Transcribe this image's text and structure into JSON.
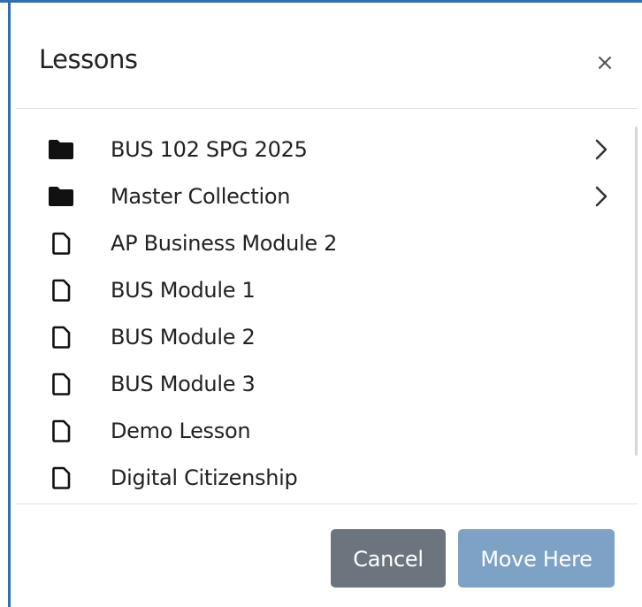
{
  "dialog": {
    "title": "Lessons",
    "close_glyph": "×",
    "close_icon": "close-icon"
  },
  "items": [
    {
      "label": "BUS 102 SPG 2025",
      "type": "folder",
      "icon": "folder-icon",
      "has_children": true
    },
    {
      "label": "Master Collection",
      "type": "folder",
      "icon": "folder-icon",
      "has_children": true
    },
    {
      "label": "AP Business Module 2",
      "type": "lesson",
      "icon": "file-icon",
      "has_children": false
    },
    {
      "label": "BUS Module 1",
      "type": "lesson",
      "icon": "file-icon",
      "has_children": false
    },
    {
      "label": "BUS Module 2",
      "type": "lesson",
      "icon": "file-icon",
      "has_children": false
    },
    {
      "label": "BUS Module 3",
      "type": "lesson",
      "icon": "file-icon",
      "has_children": false
    },
    {
      "label": "Demo Lesson",
      "type": "lesson",
      "icon": "file-icon",
      "has_children": false
    },
    {
      "label": "Digital Citizenship",
      "type": "lesson",
      "icon": "file-icon",
      "has_children": false
    }
  ],
  "footer": {
    "cancel_label": "Cancel",
    "move_label": "Move Here"
  },
  "colors": {
    "frame_border": "#2f6fb0",
    "cancel_bg": "#6c757d",
    "move_bg": "#7ea2c6",
    "text": "#222222"
  }
}
